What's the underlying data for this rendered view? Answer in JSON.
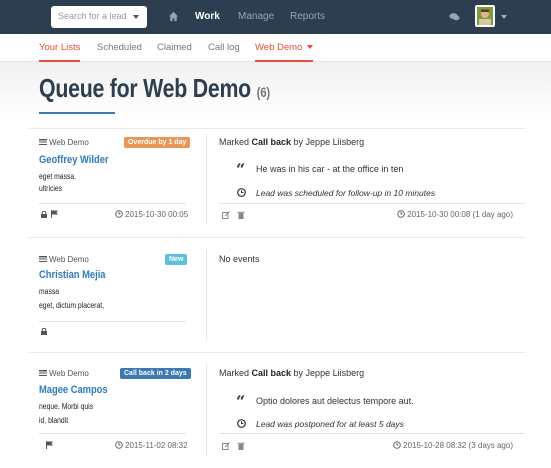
{
  "topnav": {
    "search_placeholder": "Search for a lead",
    "items": [
      {
        "label": "Work",
        "active": true
      },
      {
        "label": "Manage",
        "active": false
      },
      {
        "label": "Reports",
        "active": false
      }
    ]
  },
  "subnav": {
    "tabs": [
      "Your Lists",
      "Scheduled",
      "Claimed",
      "Call log",
      "Web Demo"
    ]
  },
  "page": {
    "title": "Queue for Web Demo",
    "count": "(6)"
  },
  "leads": [
    {
      "list": "Web Demo",
      "badge": "Overdue by 1 day",
      "badge_color": "#e8965a",
      "name": "Geoffrey Wilder",
      "lines": [
        "eget massa.",
        "ultricies"
      ],
      "left_time": "2015-10-30 00:05",
      "event_prefix": "Marked ",
      "event_action": "Call back",
      "event_suffix": " by Jeppe Liisberg",
      "quote": "He was in his car - at the office in ten",
      "note": "Lead was scheduled for follow-up in 10 minutes",
      "right_time": "2015-10-30 00:08 (1 day ago)"
    },
    {
      "list": "Web Demo",
      "badge": "New",
      "badge_color": "#5bc0de",
      "name": "Christian Mejia",
      "lines": [
        "massa",
        "eget, dictum placerat,"
      ],
      "event_text": "No events"
    },
    {
      "list": "Web Demo",
      "badge": "Call back in 2 days",
      "badge_color": "#3b78b5",
      "name": "Magee Campos",
      "lines": [
        "neque. Morbi quis",
        "id, blandit"
      ],
      "left_time": "2015-11-02 08:32",
      "event_prefix": "Marked ",
      "event_action": "Call back",
      "event_suffix": " by Jeppe Liisberg",
      "quote": "Optio dolores aut delectus tempore aut.",
      "note": "Lead was postponed for at least 5 days",
      "right_time": "2015-10-28 08:32 (3 days ago)"
    }
  ],
  "colors": {
    "navbar": "#2c3e50",
    "accent_red": "#e74c3c",
    "link_blue": "#2f7bbf"
  }
}
